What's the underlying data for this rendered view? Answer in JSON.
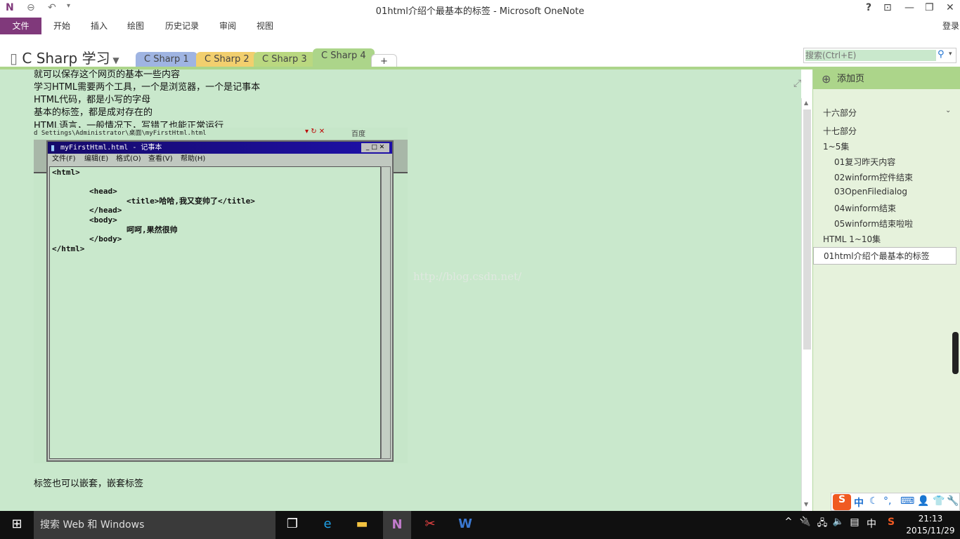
{
  "window": {
    "title": "01html介绍个最基本的标签 - Microsoft OneNote",
    "help": "?",
    "signin": "登录"
  },
  "ribbon": {
    "tabs": [
      "文件",
      "开始",
      "插入",
      "绘图",
      "历史记录",
      "审阅",
      "视图"
    ]
  },
  "notebook": {
    "name": "C Sharp 学习",
    "sections": [
      {
        "label": "C Sharp 1",
        "color": "#9fb4e2"
      },
      {
        "label": "C Sharp 2",
        "color": "#f2cf6e"
      },
      {
        "label": "C Sharp 3",
        "color": "#bad880"
      },
      {
        "label": "C Sharp 4",
        "color": "#acd58a"
      }
    ],
    "add": "+"
  },
  "search": {
    "placeholder": "搜索(Ctrl+E)"
  },
  "note": {
    "lines": [
      "就可以保存这个网页的基本一些内容",
      "学习HTML需要两个工具，一个是浏览器，一个是记事本",
      "HTML代码，都是小写的字母",
      "基本的标签，都是成对存在的",
      "HTML语言，一般情况下，写错了也能正常运行"
    ],
    "last_line": "标签也可以嵌套，嵌套标签",
    "screenshot": {
      "address": "d Settings\\Administrator\\桌面\\myFirstHtml.html",
      "baidu": "百度",
      "notepad": {
        "title": "myFirstHtml.html - 记事本",
        "menu": [
          "文件(F)",
          "编辑(E)",
          "格式(O)",
          "查看(V)",
          "帮助(H)"
        ],
        "text": "<html>\n\n        <head>\n                <title>哈哈,我又变帅了</title>\n        </head>\n        <body>\n                呵呵,果然很帅\n        </body>\n</html>"
      }
    },
    "watermark": "http://blog.csdn.net/"
  },
  "pages": {
    "add_label": "添加页",
    "items": [
      {
        "label": "十六部分",
        "level": 0
      },
      {
        "label": "十七部分",
        "level": 0
      },
      {
        "label": "1~5集",
        "level": 0
      },
      {
        "label": "01复习昨天内容",
        "level": 1
      },
      {
        "label": "02winform控件结束",
        "level": 1
      },
      {
        "label": "03OpenFiledialog",
        "level": 1
      },
      {
        "label": "04winform结束",
        "level": 1
      },
      {
        "label": "05winform结束啦啦",
        "level": 1
      },
      {
        "label": "HTML 1~10集",
        "level": 0
      },
      {
        "label": "01html介绍个最基本的标签",
        "level": 0,
        "selected": true
      }
    ]
  },
  "ime": {
    "mode": "中"
  },
  "taskbar": {
    "search": "搜索 Web 和 Windows",
    "lang": "中",
    "time": "21:13",
    "date": "2015/11/29"
  }
}
